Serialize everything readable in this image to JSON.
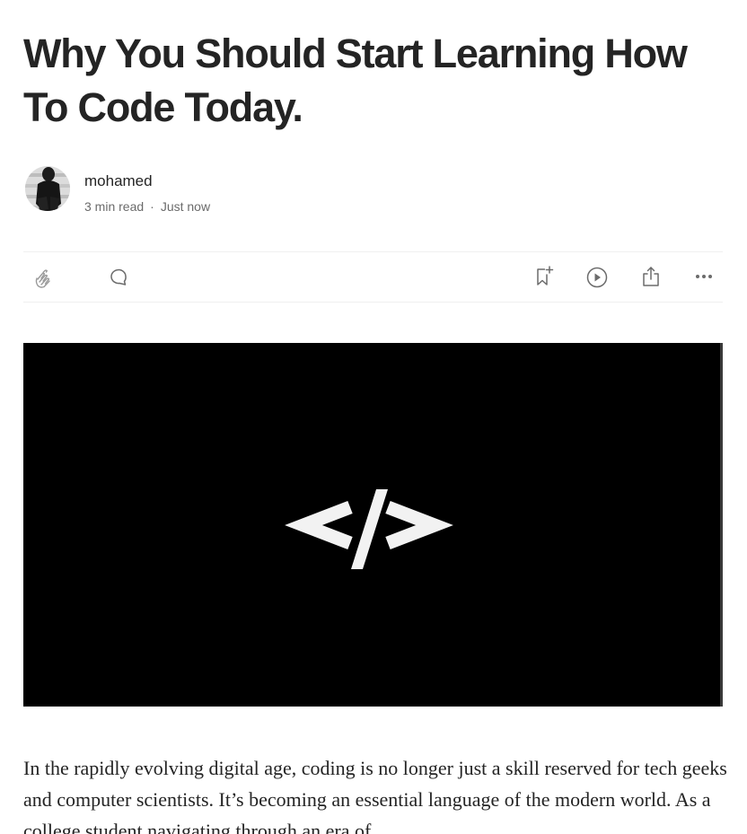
{
  "article": {
    "title": "Why You Should Start Learning How To Code Today.",
    "author": {
      "name": "mohamed",
      "avatar_icon": "person-photo-avatar"
    },
    "read_time": "3 min read",
    "separator": "·",
    "published": "Just now",
    "actions": {
      "clap_icon": "clap-icon",
      "comment_icon": "comment-icon",
      "save_icon": "bookmark-add-icon",
      "listen_icon": "play-icon",
      "share_icon": "share-icon",
      "more_icon": "more-icon"
    },
    "hero_image": {
      "symbol": "code-brackets-symbol",
      "background": "#000000",
      "foreground": "#f2f2f2"
    },
    "body": "In the rapidly evolving digital age, coding is no longer just a skill reserved for tech geeks and computer scientists. It’s becoming an essential language of the modern world. As a college student navigating through an era of"
  },
  "colors": {
    "text": "#242424",
    "muted": "#6b6b6b",
    "divider": "#f0f0f0"
  }
}
